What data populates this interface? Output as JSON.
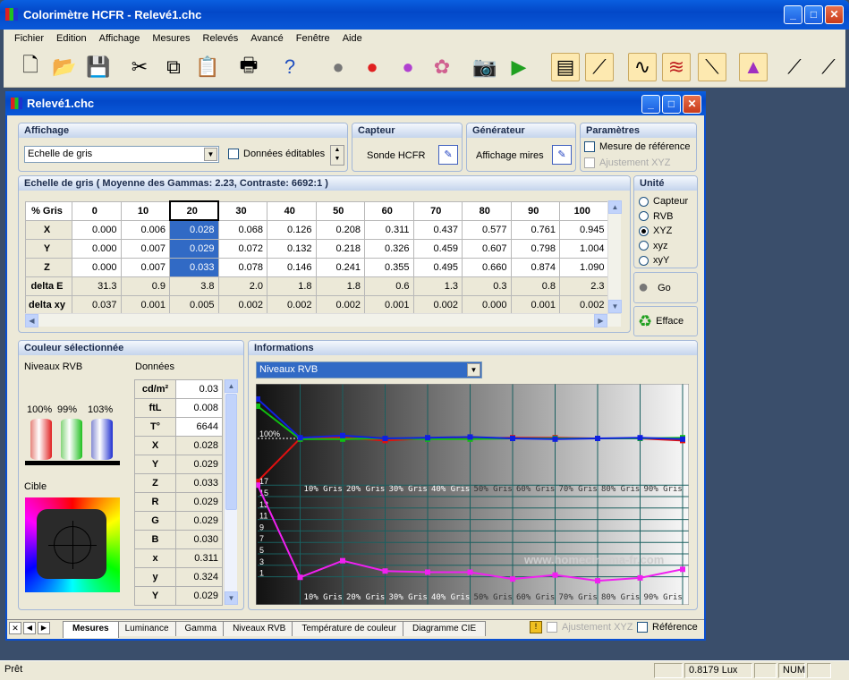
{
  "app": {
    "title": "Colorimètre HCFR - Relevé1.chc"
  },
  "menu": [
    "Fichier",
    "Edition",
    "Affichage",
    "Mesures",
    "Relevés",
    "Avancé",
    "Fenêtre",
    "Aide"
  ],
  "child": {
    "title": "Relevé1.chc"
  },
  "affichage": {
    "header": "Affichage",
    "select": "Echelle de gris",
    "editable": "Données éditables"
  },
  "capteur": {
    "header": "Capteur",
    "label": "Sonde HCFR"
  },
  "generateur": {
    "header": "Générateur",
    "label": "Affichage mires"
  },
  "parametres": {
    "header": "Paramètres",
    "ref": "Mesure de référence",
    "adj": "Ajustement XYZ"
  },
  "grid": {
    "header": "Echelle de gris ( Moyenne des Gammas: 2.23, Contraste: 6692:1 )",
    "columns": [
      "% Gris",
      "0",
      "10",
      "20",
      "30",
      "40",
      "50",
      "60",
      "70",
      "80",
      "90",
      "100"
    ],
    "rows": [
      {
        "label": "X",
        "values": [
          "0.000",
          "0.006",
          "0.028",
          "0.068",
          "0.126",
          "0.208",
          "0.311",
          "0.437",
          "0.577",
          "0.761",
          "0.945"
        ]
      },
      {
        "label": "Y",
        "values": [
          "0.000",
          "0.007",
          "0.029",
          "0.072",
          "0.132",
          "0.218",
          "0.326",
          "0.459",
          "0.607",
          "0.798",
          "1.004"
        ]
      },
      {
        "label": "Z",
        "values": [
          "0.000",
          "0.007",
          "0.033",
          "0.078",
          "0.146",
          "0.241",
          "0.355",
          "0.495",
          "0.660",
          "0.874",
          "1.090"
        ]
      },
      {
        "label": "delta E",
        "values": [
          "31.3",
          "0.9",
          "3.8",
          "2.0",
          "1.8",
          "1.8",
          "0.6",
          "1.3",
          "0.3",
          "0.8",
          "2.3"
        ]
      },
      {
        "label": "delta xy",
        "values": [
          "0.037",
          "0.001",
          "0.005",
          "0.002",
          "0.002",
          "0.002",
          "0.001",
          "0.002",
          "0.000",
          "0.001",
          "0.002"
        ]
      }
    ]
  },
  "unite": {
    "header": "Unité",
    "options": [
      "Capteur",
      "RVB",
      "XYZ",
      "xyz",
      "xyY"
    ],
    "selected": "XYZ",
    "go": "Go",
    "efface": "Efface"
  },
  "couleur": {
    "header": "Couleur sélectionnée",
    "niveaux": "Niveaux RVB",
    "donnees": "Données",
    "cible": "Cible",
    "bars": [
      {
        "label": "100%",
        "color": "#e02020"
      },
      {
        "label": "99%",
        "color": "#20c020"
      },
      {
        "label": "103%",
        "color": "#2030d0"
      }
    ],
    "data": [
      [
        "cd/m²",
        "0.03"
      ],
      [
        "ftL",
        "0.008"
      ],
      [
        "T°",
        "6644"
      ],
      [
        "X",
        "0.028"
      ],
      [
        "Y",
        "0.029"
      ],
      [
        "Z",
        "0.033"
      ],
      [
        "R",
        "0.029"
      ],
      [
        "G",
        "0.029"
      ],
      [
        "B",
        "0.030"
      ],
      [
        "x",
        "0.311"
      ],
      [
        "y",
        "0.324"
      ],
      [
        "Y",
        "0.029"
      ]
    ]
  },
  "info": {
    "header": "Informations",
    "select": "Niveaux RVB",
    "xlabels": [
      "10% Gris",
      "20% Gris",
      "30% Gris",
      "40% Gris",
      "50% Gris",
      "60% Gris",
      "70% Gris",
      "80% Gris",
      "90% Gris"
    ],
    "ref_label": "100%",
    "watermark": "www.homecinema-fr.com",
    "yticks": [
      "17",
      "15",
      "13",
      "11",
      "9",
      "7",
      "5",
      "3",
      "1"
    ],
    "chart_data": {
      "type": "line",
      "x": [
        0,
        10,
        20,
        30,
        40,
        50,
        60,
        70,
        80,
        90,
        100
      ],
      "series": [
        {
          "color": "#e01010",
          "values": [
            40,
            100,
            101,
            97,
            100,
            100,
            101,
            101,
            100,
            100,
            97
          ]
        },
        {
          "color": "#10c010",
          "values": [
            145,
            99,
            99,
            100,
            99,
            99,
            100,
            100,
            100,
            100,
            101
          ]
        },
        {
          "color": "#1020e0",
          "values": [
            155,
            101,
            104,
            100,
            101,
            102,
            100,
            99,
            100,
            101,
            99
          ]
        }
      ],
      "delta_series": {
        "color": "#f020f0",
        "values": [
          17,
          0.9,
          3.8,
          2.0,
          1.8,
          1.8,
          0.6,
          1.3,
          0.3,
          0.8,
          2.3
        ]
      }
    }
  },
  "tabs": [
    "Mesures",
    "Luminance",
    "Gamma",
    "Niveaux RVB",
    "Température de couleur",
    "Diagramme CIE"
  ],
  "bottom": {
    "adj": "Ajustement XYZ",
    "ref": "Référence"
  },
  "status": {
    "ready": "Prêt",
    "lux": "0.8179 Lux",
    "num": "NUM"
  }
}
